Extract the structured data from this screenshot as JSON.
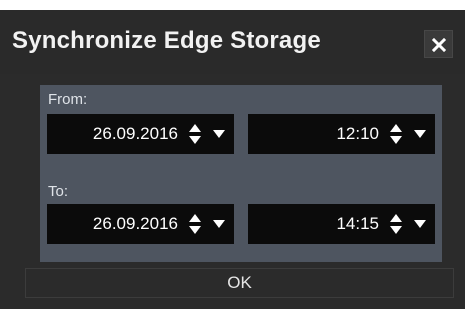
{
  "dialog": {
    "title": "Synchronize Edge Storage",
    "close_icon": "close-icon"
  },
  "from": {
    "label": "From:",
    "date": "26.09.2016",
    "time": "12:10"
  },
  "to": {
    "label": "To:",
    "date": "26.09.2016",
    "time": "14:15"
  },
  "footer": {
    "ok_label": "OK"
  },
  "colors": {
    "background": "#2b2b2b",
    "panel": "#4e5560",
    "field": "#0b0b0b",
    "text": "#ffffff"
  }
}
